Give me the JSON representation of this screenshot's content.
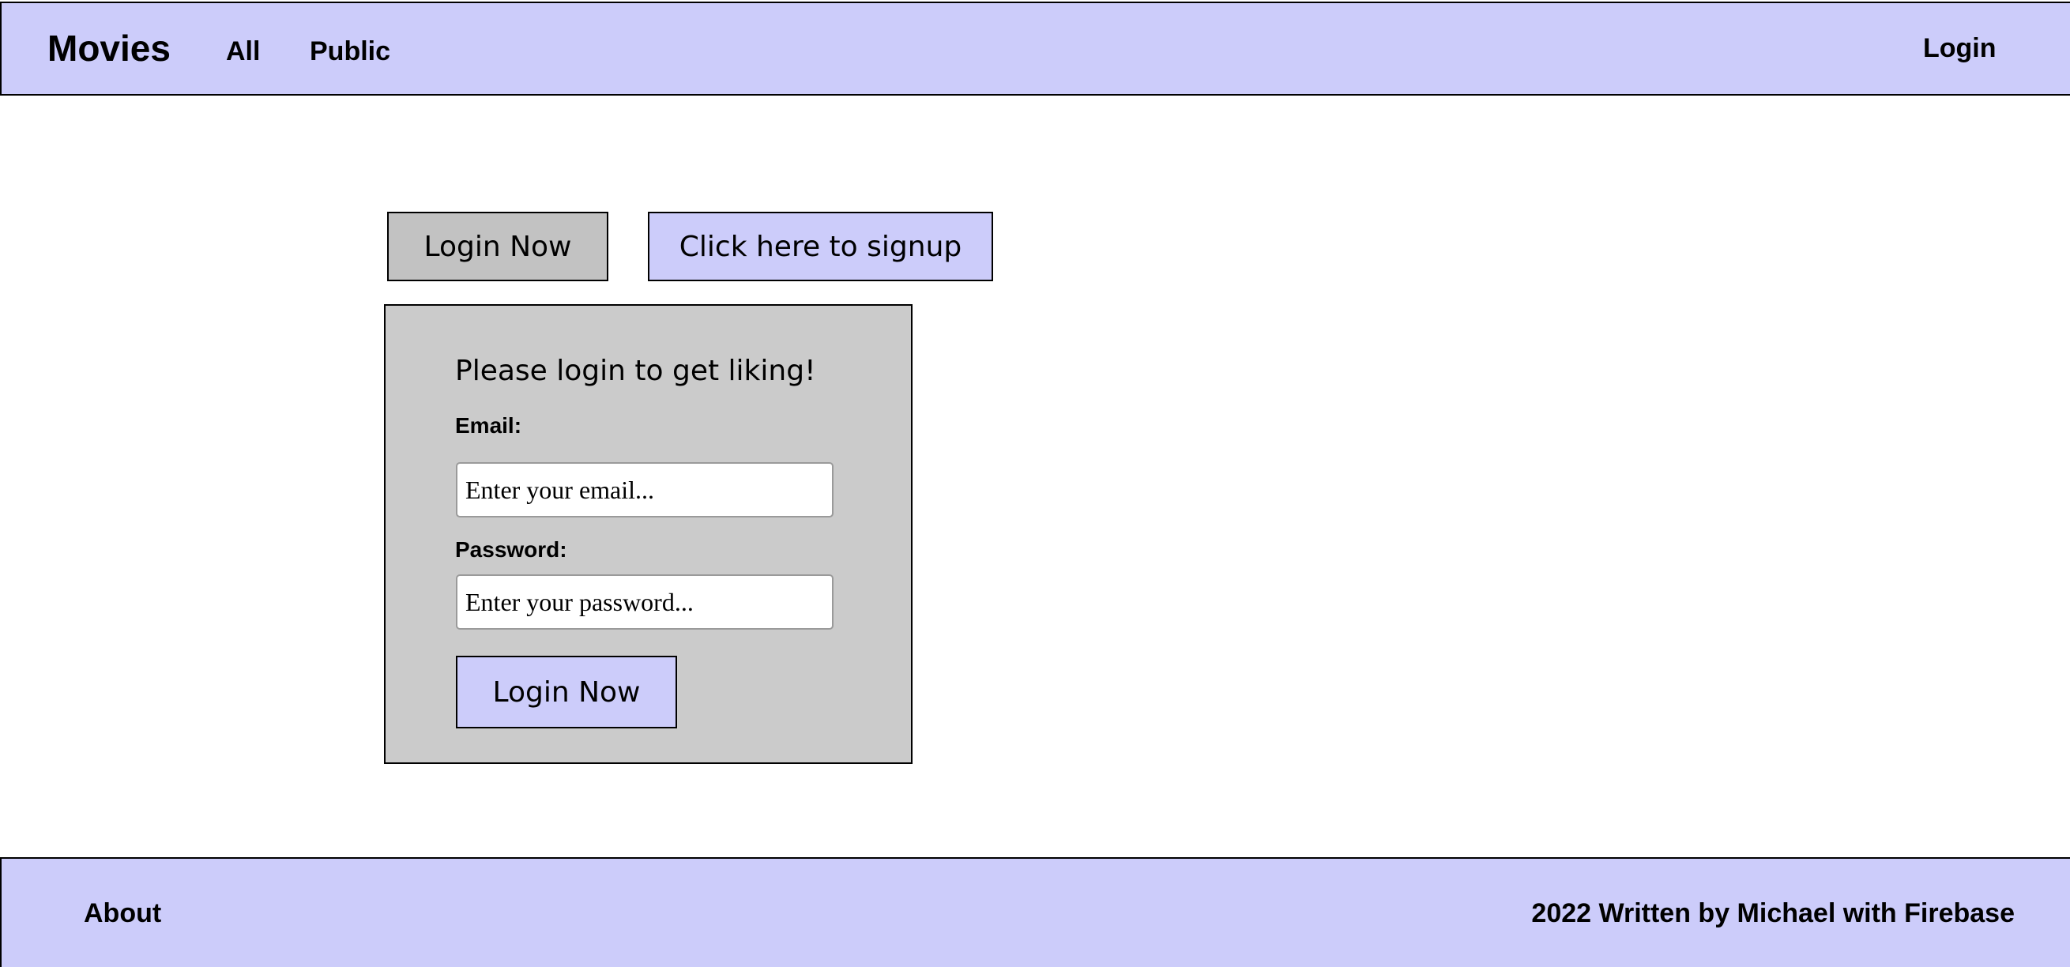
{
  "header": {
    "brand": "Movies",
    "nav": {
      "all": "All",
      "public": "Public"
    },
    "login": "Login"
  },
  "tabs": {
    "login_now": "Login Now",
    "signup": "Click here to signup"
  },
  "login_form": {
    "heading": "Please login to get liking!",
    "email_label": "Email:",
    "email_placeholder": "Enter your email...",
    "email_value": "",
    "password_label": "Password:",
    "password_placeholder": "Enter your password...",
    "password_value": "",
    "submit_label": "Login Now"
  },
  "footer": {
    "about": "About",
    "credit": "2022 Written by Michael with Firebase"
  },
  "colors": {
    "bar_background": "#ccccfa",
    "panel_background": "#cbcbcb",
    "active_tab": "#c2c2c2"
  }
}
